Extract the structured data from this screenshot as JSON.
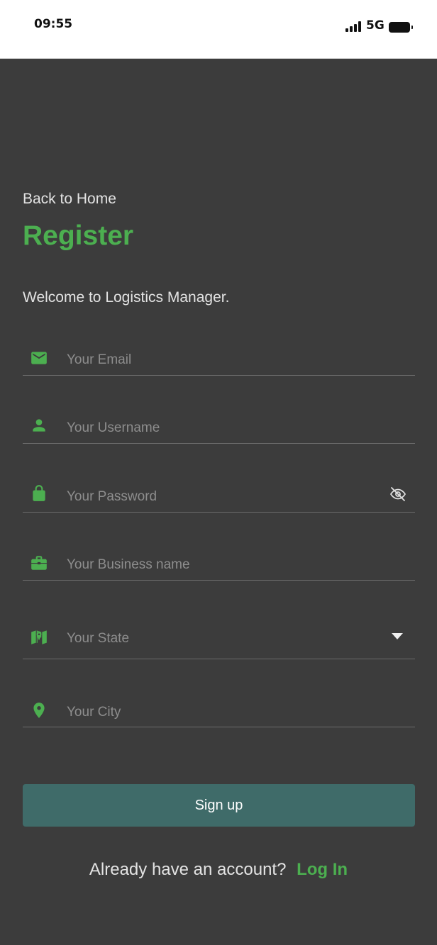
{
  "status_bar": {
    "time": "09:55",
    "network": "5G"
  },
  "header": {
    "back_label": "Back to Home",
    "title": "Register",
    "welcome": "Welcome to Logistics Manager."
  },
  "form": {
    "email": {
      "placeholder": "Your Email",
      "icon": "email-icon"
    },
    "username": {
      "placeholder": "Your Username",
      "icon": "person-icon"
    },
    "password": {
      "placeholder": "Your Password",
      "icon": "lock-icon",
      "toggle_icon": "eye-off-icon"
    },
    "business": {
      "placeholder": "Your Business name",
      "icon": "briefcase-icon"
    },
    "state": {
      "placeholder": "Your State",
      "icon": "map-icon",
      "dropdown_icon": "caret-down-icon"
    },
    "city": {
      "placeholder": "Your City",
      "icon": "location-pin-icon"
    }
  },
  "actions": {
    "signup_label": "Sign up",
    "footer_text": "Already have an account?",
    "login_label": "Log In"
  },
  "colors": {
    "accent": "#4caf50",
    "button": "#3f6b69",
    "background": "#3c3c3c"
  }
}
